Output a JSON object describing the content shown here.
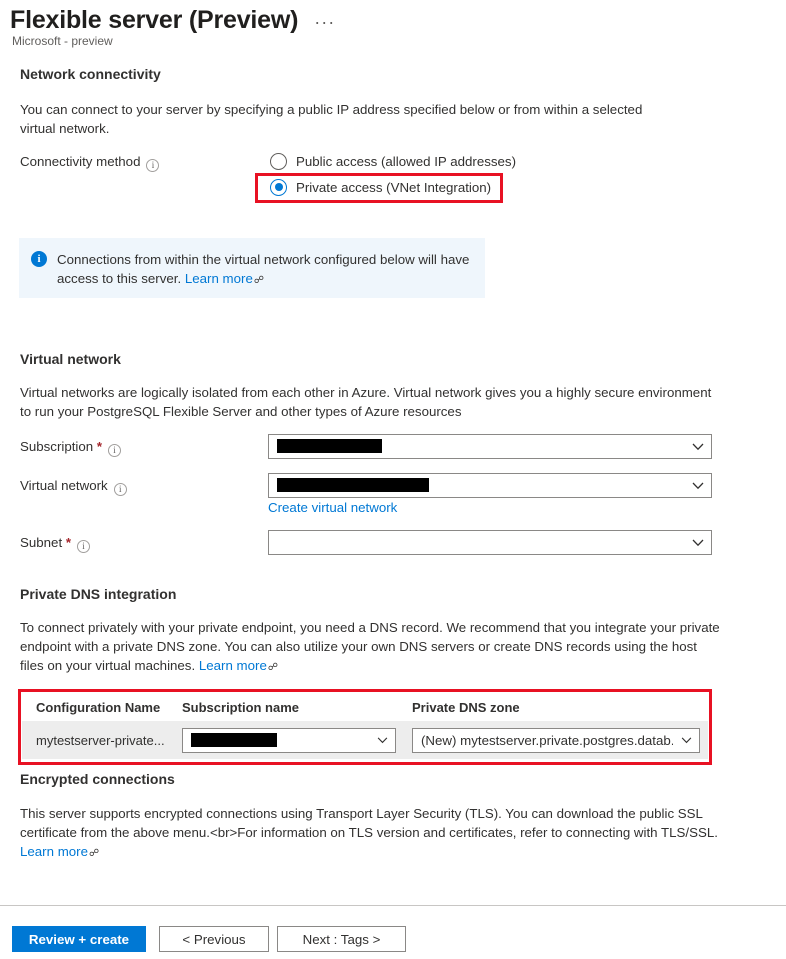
{
  "header": {
    "title": "Flexible server (Preview)",
    "subtitle": "Microsoft - preview",
    "more_menu": "···"
  },
  "network_connectivity": {
    "heading": "Network connectivity",
    "description": "You can connect to your server by specifying a public IP address specified below or from within a selected virtual network.",
    "connectivity_method_label": "Connectivity method",
    "options": [
      {
        "label": "Public access (allowed IP addresses)",
        "selected": false
      },
      {
        "label": "Private access (VNet Integration)",
        "selected": true
      }
    ]
  },
  "info_banner": {
    "icon": "info-icon",
    "text": "Connections from within the virtual network configured below will have access to this server.",
    "link_label": "Learn more",
    "external_glyph": "↗"
  },
  "virtual_network": {
    "heading": "Virtual network",
    "description": "Virtual networks are logically isolated from each other in Azure. Virtual network gives you a highly secure environment to run your PostgreSQL Flexible Server and other types of Azure resources",
    "fields": [
      {
        "label": "Subscription",
        "required": true,
        "value": "",
        "redacted": true,
        "redacted_width": 105
      },
      {
        "label": "Virtual network",
        "required": false,
        "value": "",
        "redacted": true,
        "redacted_width": 152
      },
      {
        "label": "Subnet",
        "required": true,
        "value": "",
        "redacted": false,
        "redacted_width": 0
      }
    ],
    "create_vnet_link": "Create virtual network"
  },
  "private_dns": {
    "heading": "Private DNS integration",
    "description": "To connect privately with your private endpoint, you need a DNS record. We recommend that you integrate your private endpoint with a private DNS zone. You can also utilize your own DNS servers or create DNS records using the host files on your virtual machines.",
    "link_label": "Learn more",
    "columns": [
      "Configuration Name",
      "Subscription name",
      "Private DNS zone"
    ],
    "rows": [
      {
        "configuration_name": "mytestserver-private...",
        "subscription_name": "",
        "subscription_redacted": true,
        "subscription_redacted_width": 86,
        "private_dns_zone": "(New) mytestserver.private.postgres.datab..."
      }
    ]
  },
  "encrypted_connections": {
    "heading": "Encrypted connections",
    "description": "This server supports encrypted connections using Transport Layer Security (TLS). You can download the public SSL certificate from the above menu.<br>For information on TLS version and certificates, refer to connecting with TLS/SSL.",
    "link_label": "Learn more"
  },
  "footer": {
    "review_create": "Review + create",
    "previous": "< Previous",
    "next": "Next : Tags >"
  },
  "colors": {
    "accent": "#0078d4",
    "annotation": "#e81123",
    "banner_bg": "#eff6fc",
    "required": "#a4262c",
    "row_bg": "#ededed"
  }
}
